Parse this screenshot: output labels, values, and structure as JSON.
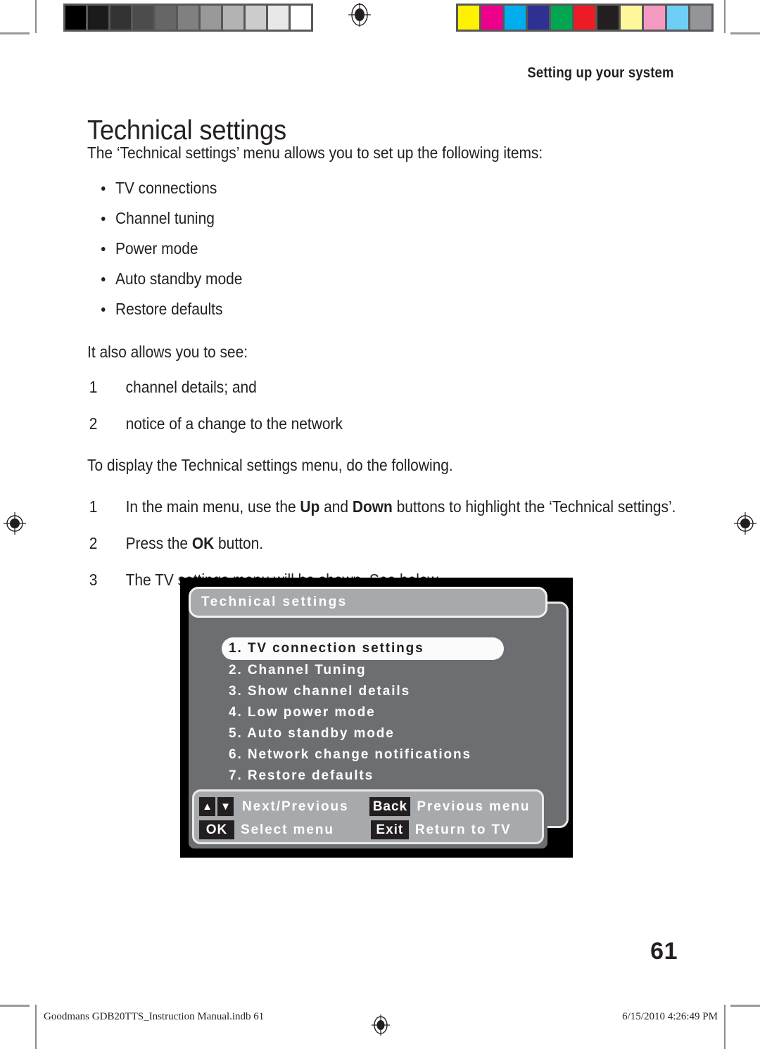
{
  "calibration": {
    "gray_bar": [
      "#000000",
      "#1b1b1b",
      "#333333",
      "#4c4c4c",
      "#666666",
      "#808080",
      "#999999",
      "#b3b3b3",
      "#cccccc",
      "#e8e8e8",
      "#ffffff"
    ],
    "color_bar": [
      "#fff200",
      "#ec008c",
      "#00aeef",
      "#2e3192",
      "#00a651",
      "#ed1c24",
      "#231f20",
      "#fff79a",
      "#f49ac1",
      "#6dcff6",
      "#939598"
    ]
  },
  "header": {
    "running_head": "Setting up your system"
  },
  "title": "Technical settings",
  "body": {
    "intro": "The ‘Technical settings’ menu allows you to set up the following items:",
    "bullets": [
      "TV connections",
      "Channel tuning",
      "Power mode",
      "Auto standby mode",
      "Restore defaults"
    ],
    "also_intro": "It also allows you to see:",
    "see_items": [
      {
        "num": "1",
        "text": "channel details; and"
      },
      {
        "num": "2",
        "text": "notice of a change to the network"
      }
    ],
    "display_intro": "To display the Technical settings menu, do the following.",
    "steps": [
      {
        "num": "1",
        "parts": [
          {
            "t": "In the main menu, use the ",
            "bold": false
          },
          {
            "t": "Up",
            "bold": true
          },
          {
            "t": " and ",
            "bold": false
          },
          {
            "t": "Down",
            "bold": true
          },
          {
            "t": " buttons to highlight the ‘Technical settings’.",
            "bold": false
          }
        ]
      },
      {
        "num": "2",
        "parts": [
          {
            "t": "Press the ",
            "bold": false
          },
          {
            "t": "OK",
            "bold": true
          },
          {
            "t": " button.",
            "bold": false
          }
        ]
      },
      {
        "num": "3",
        "parts": [
          {
            "t": "The TV settings menu will be shown. See below.",
            "bold": false
          }
        ]
      }
    ]
  },
  "tv_menu": {
    "title": "Technical settings",
    "items": [
      {
        "label": "1. TV connection settings",
        "selected": true
      },
      {
        "label": "2. Channel Tuning",
        "selected": false
      },
      {
        "label": "3. Show channel details",
        "selected": false
      },
      {
        "label": "4. Low power mode",
        "selected": false
      },
      {
        "label": "5. Auto standby mode",
        "selected": false
      },
      {
        "label": "6. Network change notifications",
        "selected": false
      },
      {
        "label": "7. Restore defaults",
        "selected": false
      }
    ],
    "footer": {
      "up_key": "▲",
      "down_key": "▼",
      "nav_label": "Next/Previous",
      "back_key": "Back",
      "back_label": "Previous menu",
      "ok_key": "OK",
      "ok_label": "Select menu",
      "exit_key": "Exit",
      "exit_label": "Return to TV"
    },
    "colors": {
      "frame": "#000000",
      "panel": "#6d6e71",
      "bar": "#a7a9ac",
      "highlight": "#fbfbfb",
      "key": "#231f20"
    }
  },
  "page_number": "61",
  "colophon": {
    "left": "Goodmans GDB20TTS_Instruction Manual.indb   61",
    "right": "6/15/2010   4:26:49 PM"
  }
}
